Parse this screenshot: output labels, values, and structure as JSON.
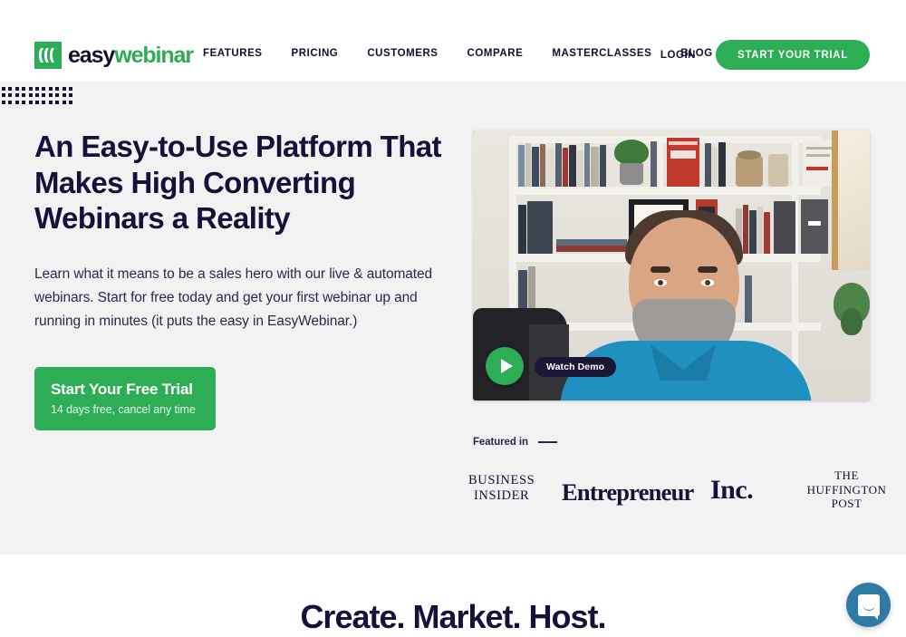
{
  "brand": {
    "logo_easy": "easy",
    "logo_webinar": "webinar",
    "logo_icon": "easywebinar-arcs-icon",
    "green": "#2DAD55",
    "navy": "#15113A"
  },
  "nav": {
    "links": [
      {
        "label": "FEATURES"
      },
      {
        "label": "PRICING"
      },
      {
        "label": "CUSTOMERS"
      },
      {
        "label": "COMPARE"
      },
      {
        "label": "MASTERCLASSES"
      },
      {
        "label": "BLOG"
      }
    ],
    "login_label": "LOGIN",
    "trial_label": "START YOUR TRIAL"
  },
  "hero": {
    "title": "An Easy-to-Use Platform That Makes High Converting Webinars a Reality",
    "subtitle": "Learn what it means to be a sales hero with our live & automated webinars. Start for free today and get your first webinar up and running in minutes (it puts the easy in EasyWebinar.)",
    "cta_main": "Start Your Free Trial",
    "cta_sub": "14 days free, cancel any time"
  },
  "video": {
    "watch_label": "Watch Demo",
    "play_icon": "play-triangle-icon"
  },
  "featured": {
    "label": "Featured in",
    "logos": [
      {
        "name": "business-insider",
        "line1": "BUSINESS",
        "line2": "INSIDER"
      },
      {
        "name": "entrepreneur",
        "text": "Entrepreneur"
      },
      {
        "name": "inc",
        "text": "Inc."
      },
      {
        "name": "huffington-post",
        "line1": "THE",
        "line2": "HUFFINGTON",
        "line3": "POST"
      }
    ]
  },
  "lower": {
    "title": "Create. Market. Host."
  },
  "chat": {
    "icon": "chat-bubble-icon",
    "color": "#2E7BA6"
  }
}
